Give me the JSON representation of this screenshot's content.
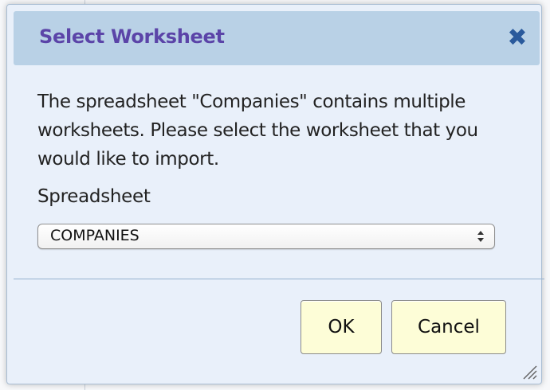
{
  "dialog": {
    "title": "Select Worksheet",
    "close_icon": "close-icon",
    "message": "The spreadsheet \"Companies\" contains multiple worksheets. Please select the worksheet that you would like to import.",
    "field_label": "Spreadsheet",
    "select": {
      "selected": "COMPANIES"
    },
    "buttons": {
      "ok": "OK",
      "cancel": "Cancel"
    }
  },
  "colors": {
    "title": "#5b44a8",
    "titlebar": "#b9d1e6",
    "dialog_bg": "#e9f0fa",
    "button_bg": "#fdfdd7",
    "close_icon": "#2a5a9c"
  }
}
